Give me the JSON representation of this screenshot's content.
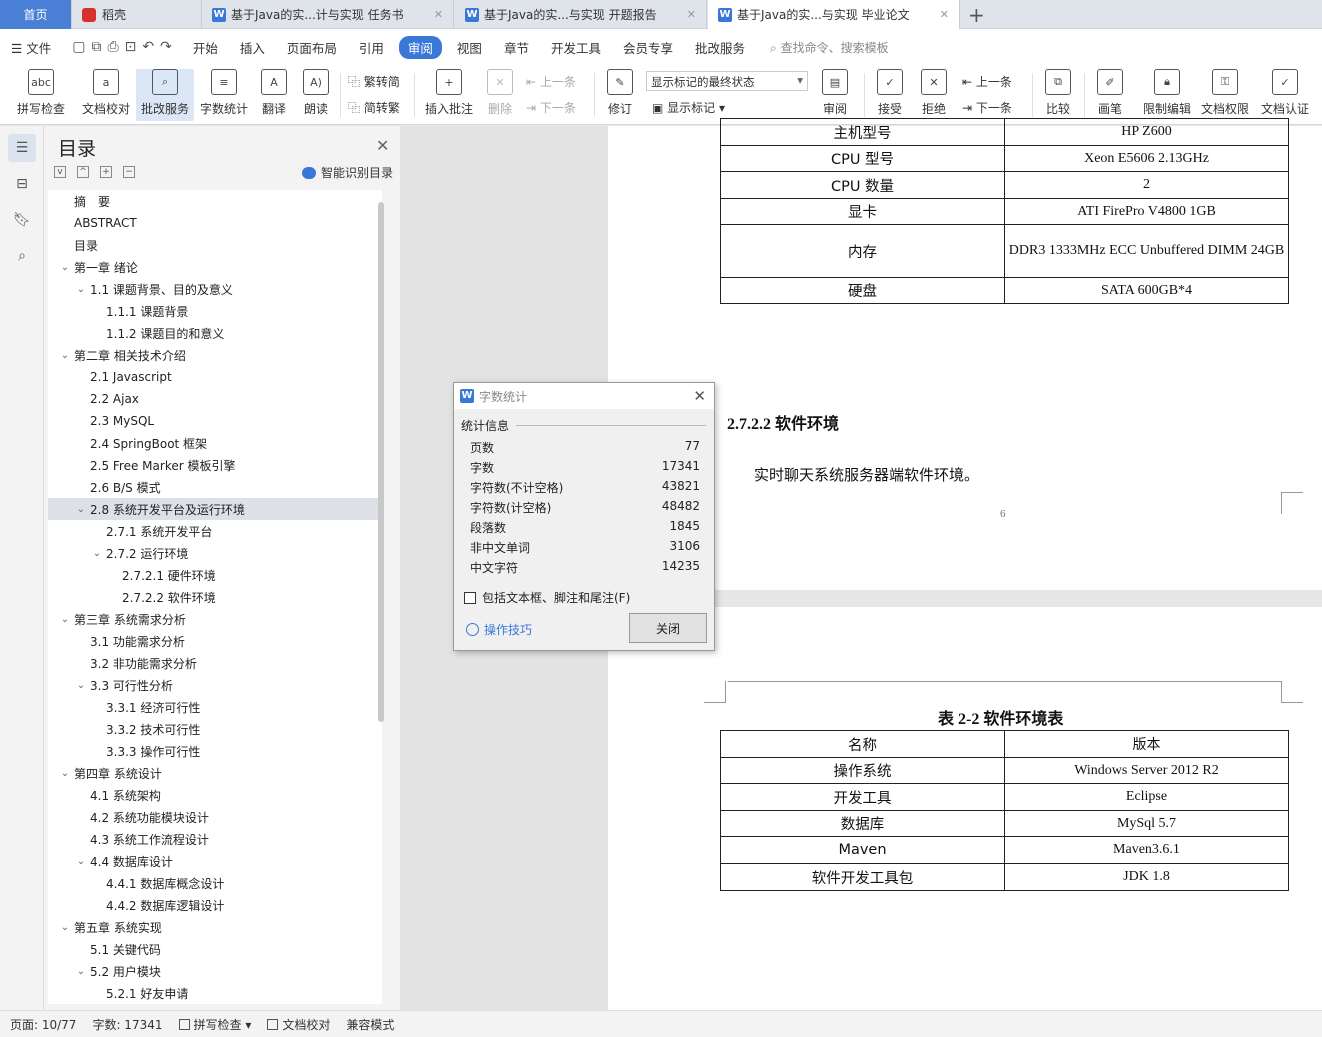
{
  "tabs": {
    "home": "首页",
    "daoke": "稻壳",
    "doc1": "基于Java的实...计与实现 任务书",
    "doc2": "基于Java的实...与实现 开题报告",
    "doc3": "基于Java的实...与实现 毕业论文"
  },
  "menu": {
    "file": "文件",
    "items": [
      "开始",
      "插入",
      "页面布局",
      "引用",
      "审阅",
      "视图",
      "章节",
      "开发工具",
      "会员专享",
      "批改服务"
    ],
    "search": "查找命令、搜索模板"
  },
  "ribbon": {
    "spell": "拼写检查",
    "proof": "文档校对",
    "correct": "批改服务",
    "wordcount": "字数统计",
    "translate": "翻译",
    "read": "朗读",
    "to_trad": "繁转简",
    "to_simp": "简转繁",
    "insert_comment": "插入批注",
    "delete": "删除",
    "prev_comment": "上一条",
    "next_comment": "下一条",
    "revise": "修订",
    "markup_state": "显示标记的最终状态",
    "show_markup": "显示标记",
    "review": "审阅",
    "accept": "接受",
    "reject": "拒绝",
    "prev": "上一条",
    "next": "下一条",
    "compare": "比较",
    "pen": "画笔",
    "restrict": "限制编辑",
    "permission": "文档权限",
    "certify": "文档认证"
  },
  "nav": {
    "title": "目录",
    "smart": "智能识别目录",
    "items": [
      {
        "label": "摘　要",
        "level": 0,
        "arrow": ""
      },
      {
        "label": "ABSTRACT",
        "level": 0,
        "arrow": ""
      },
      {
        "label": "目录",
        "level": 0,
        "arrow": ""
      },
      {
        "label": "第一章  绪论",
        "level": 0,
        "arrow": "v"
      },
      {
        "label": "1.1  课题背景、目的及意义",
        "level": 1,
        "arrow": "v"
      },
      {
        "label": "1.1.1  课题背景",
        "level": 2,
        "arrow": ""
      },
      {
        "label": "1.1.2  课题目的和意义",
        "level": 2,
        "arrow": ""
      },
      {
        "label": "第二章  相关技术介绍",
        "level": 0,
        "arrow": "v"
      },
      {
        "label": "2.1 Javascript",
        "level": 1,
        "arrow": ""
      },
      {
        "label": "2.2 Ajax",
        "level": 1,
        "arrow": ""
      },
      {
        "label": "2.3 MySQL",
        "level": 1,
        "arrow": ""
      },
      {
        "label": "2.4 SpringBoot 框架",
        "level": 1,
        "arrow": ""
      },
      {
        "label": "2.5 Free Marker 模板引擎",
        "level": 1,
        "arrow": ""
      },
      {
        "label": "2.6 B/S 模式",
        "level": 1,
        "arrow": ""
      },
      {
        "label": "2.8  系统开发平台及运行环境",
        "level": 1,
        "arrow": "v",
        "selected": true
      },
      {
        "label": "2.7.1  系统开发平台",
        "level": 2,
        "arrow": ""
      },
      {
        "label": "2.7.2  运行环境",
        "level": 2,
        "arrow": "v"
      },
      {
        "label": "2.7.2.1  硬件环境",
        "level": 3,
        "arrow": ""
      },
      {
        "label": "2.7.2.2  软件环境",
        "level": 3,
        "arrow": ""
      },
      {
        "label": "第三章  系统需求分析",
        "level": 0,
        "arrow": "v"
      },
      {
        "label": "3.1  功能需求分析",
        "level": 1,
        "arrow": ""
      },
      {
        "label": "3.2  非功能需求分析",
        "level": 1,
        "arrow": ""
      },
      {
        "label": "3.3  可行性分析",
        "level": 1,
        "arrow": "v"
      },
      {
        "label": "3.3.1  经济可行性",
        "level": 2,
        "arrow": ""
      },
      {
        "label": "3.3.2  技术可行性",
        "level": 2,
        "arrow": ""
      },
      {
        "label": "3.3.3  操作可行性",
        "level": 2,
        "arrow": ""
      },
      {
        "label": "第四章  系统设计",
        "level": 0,
        "arrow": "v"
      },
      {
        "label": "4.1  系统架构",
        "level": 1,
        "arrow": ""
      },
      {
        "label": "4.2  系统功能模块设计",
        "level": 1,
        "arrow": ""
      },
      {
        "label": "4.3  系统工作流程设计",
        "level": 1,
        "arrow": ""
      },
      {
        "label": "4.4  数据库设计",
        "level": 1,
        "arrow": "v"
      },
      {
        "label": "4.4.1  数据库概念设计",
        "level": 2,
        "arrow": ""
      },
      {
        "label": "4.4.2  数据库逻辑设计",
        "level": 2,
        "arrow": ""
      },
      {
        "label": "第五章  系统实现",
        "level": 0,
        "arrow": "v"
      },
      {
        "label": "5.1  关键代码",
        "level": 1,
        "arrow": ""
      },
      {
        "label": "5.2  用户模块",
        "level": 1,
        "arrow": "v"
      },
      {
        "label": "5.2.1  好友申请",
        "level": 2,
        "arrow": ""
      }
    ]
  },
  "doc": {
    "hw_rows": [
      [
        "主机型号",
        "HP Z600"
      ],
      [
        "CPU 型号",
        "Xeon E5606 2.13GHz"
      ],
      [
        "CPU 数量",
        "2"
      ],
      [
        "显卡",
        "ATI FirePro V4800 1GB"
      ],
      [
        "内存",
        "DDR3 1333MHz ECC Unbuffered DIMM 24GB"
      ],
      [
        "硬盘",
        "SATA 600GB*4"
      ]
    ],
    "heading": "2.7.2.2  软件环境",
    "paragraph": "实时聊天系统服务器端软件环境。",
    "page_number": "6",
    "table_caption": "表 2-2  软件环境表",
    "sw_rows": [
      [
        "名称",
        "版本"
      ],
      [
        "操作系统",
        "Windows Server 2012 R2"
      ],
      [
        "开发工具",
        "Eclipse"
      ],
      [
        "数据库",
        "MySql 5.7"
      ],
      [
        "Maven",
        "Maven3.6.1"
      ],
      [
        "软件开发工具包",
        "JDK 1.8"
      ]
    ]
  },
  "dialog": {
    "title": "字数统计",
    "section": "统计信息",
    "rows": [
      [
        "页数",
        "77"
      ],
      [
        "字数",
        "17341"
      ],
      [
        "字符数(不计空格)",
        "43821"
      ],
      [
        "字符数(计空格)",
        "48482"
      ],
      [
        "段落数",
        "1845"
      ],
      [
        "非中文单词",
        "3106"
      ],
      [
        "中文字符",
        "14235"
      ]
    ],
    "checkbox": "包括文本框、脚注和尾注(F)",
    "tips": "操作技巧",
    "close": "关闭"
  },
  "status": {
    "page": "页面: 10/77",
    "words": "字数: 17341",
    "spell": "拼写检查",
    "proof": "文档校对",
    "compat": "兼容模式"
  },
  "colors": {
    "accent": "#3a78d8",
    "tab_home": "#4a7fd6"
  }
}
